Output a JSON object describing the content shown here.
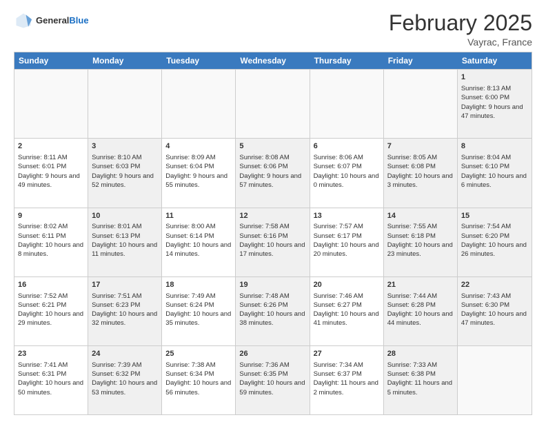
{
  "header": {
    "logo_general": "General",
    "logo_blue": "Blue",
    "month": "February 2025",
    "location": "Vayrac, France"
  },
  "days_of_week": [
    "Sunday",
    "Monday",
    "Tuesday",
    "Wednesday",
    "Thursday",
    "Friday",
    "Saturday"
  ],
  "rows": [
    {
      "cells": [
        {
          "day": "",
          "info": "",
          "empty": true
        },
        {
          "day": "",
          "info": "",
          "empty": true
        },
        {
          "day": "",
          "info": "",
          "empty": true
        },
        {
          "day": "",
          "info": "",
          "empty": true
        },
        {
          "day": "",
          "info": "",
          "empty": true
        },
        {
          "day": "",
          "info": "",
          "empty": true
        },
        {
          "day": "1",
          "info": "Sunrise: 8:13 AM\nSunset: 6:00 PM\nDaylight: 9 hours and 47 minutes.",
          "shaded": true
        }
      ]
    },
    {
      "cells": [
        {
          "day": "2",
          "info": "Sunrise: 8:11 AM\nSunset: 6:01 PM\nDaylight: 9 hours and 49 minutes."
        },
        {
          "day": "3",
          "info": "Sunrise: 8:10 AM\nSunset: 6:03 PM\nDaylight: 9 hours and 52 minutes.",
          "shaded": true
        },
        {
          "day": "4",
          "info": "Sunrise: 8:09 AM\nSunset: 6:04 PM\nDaylight: 9 hours and 55 minutes."
        },
        {
          "day": "5",
          "info": "Sunrise: 8:08 AM\nSunset: 6:06 PM\nDaylight: 9 hours and 57 minutes.",
          "shaded": true
        },
        {
          "day": "6",
          "info": "Sunrise: 8:06 AM\nSunset: 6:07 PM\nDaylight: 10 hours and 0 minutes."
        },
        {
          "day": "7",
          "info": "Sunrise: 8:05 AM\nSunset: 6:08 PM\nDaylight: 10 hours and 3 minutes.",
          "shaded": true
        },
        {
          "day": "8",
          "info": "Sunrise: 8:04 AM\nSunset: 6:10 PM\nDaylight: 10 hours and 6 minutes.",
          "shaded": true
        }
      ]
    },
    {
      "cells": [
        {
          "day": "9",
          "info": "Sunrise: 8:02 AM\nSunset: 6:11 PM\nDaylight: 10 hours and 8 minutes."
        },
        {
          "day": "10",
          "info": "Sunrise: 8:01 AM\nSunset: 6:13 PM\nDaylight: 10 hours and 11 minutes.",
          "shaded": true
        },
        {
          "day": "11",
          "info": "Sunrise: 8:00 AM\nSunset: 6:14 PM\nDaylight: 10 hours and 14 minutes."
        },
        {
          "day": "12",
          "info": "Sunrise: 7:58 AM\nSunset: 6:16 PM\nDaylight: 10 hours and 17 minutes.",
          "shaded": true
        },
        {
          "day": "13",
          "info": "Sunrise: 7:57 AM\nSunset: 6:17 PM\nDaylight: 10 hours and 20 minutes."
        },
        {
          "day": "14",
          "info": "Sunrise: 7:55 AM\nSunset: 6:18 PM\nDaylight: 10 hours and 23 minutes.",
          "shaded": true
        },
        {
          "day": "15",
          "info": "Sunrise: 7:54 AM\nSunset: 6:20 PM\nDaylight: 10 hours and 26 minutes.",
          "shaded": true
        }
      ]
    },
    {
      "cells": [
        {
          "day": "16",
          "info": "Sunrise: 7:52 AM\nSunset: 6:21 PM\nDaylight: 10 hours and 29 minutes."
        },
        {
          "day": "17",
          "info": "Sunrise: 7:51 AM\nSunset: 6:23 PM\nDaylight: 10 hours and 32 minutes.",
          "shaded": true
        },
        {
          "day": "18",
          "info": "Sunrise: 7:49 AM\nSunset: 6:24 PM\nDaylight: 10 hours and 35 minutes."
        },
        {
          "day": "19",
          "info": "Sunrise: 7:48 AM\nSunset: 6:26 PM\nDaylight: 10 hours and 38 minutes.",
          "shaded": true
        },
        {
          "day": "20",
          "info": "Sunrise: 7:46 AM\nSunset: 6:27 PM\nDaylight: 10 hours and 41 minutes."
        },
        {
          "day": "21",
          "info": "Sunrise: 7:44 AM\nSunset: 6:28 PM\nDaylight: 10 hours and 44 minutes.",
          "shaded": true
        },
        {
          "day": "22",
          "info": "Sunrise: 7:43 AM\nSunset: 6:30 PM\nDaylight: 10 hours and 47 minutes.",
          "shaded": true
        }
      ]
    },
    {
      "cells": [
        {
          "day": "23",
          "info": "Sunrise: 7:41 AM\nSunset: 6:31 PM\nDaylight: 10 hours and 50 minutes."
        },
        {
          "day": "24",
          "info": "Sunrise: 7:39 AM\nSunset: 6:32 PM\nDaylight: 10 hours and 53 minutes.",
          "shaded": true
        },
        {
          "day": "25",
          "info": "Sunrise: 7:38 AM\nSunset: 6:34 PM\nDaylight: 10 hours and 56 minutes."
        },
        {
          "day": "26",
          "info": "Sunrise: 7:36 AM\nSunset: 6:35 PM\nDaylight: 10 hours and 59 minutes.",
          "shaded": true
        },
        {
          "day": "27",
          "info": "Sunrise: 7:34 AM\nSunset: 6:37 PM\nDaylight: 11 hours and 2 minutes."
        },
        {
          "day": "28",
          "info": "Sunrise: 7:33 AM\nSunset: 6:38 PM\nDaylight: 11 hours and 5 minutes.",
          "shaded": true
        },
        {
          "day": "",
          "info": "",
          "empty": true
        }
      ]
    }
  ]
}
